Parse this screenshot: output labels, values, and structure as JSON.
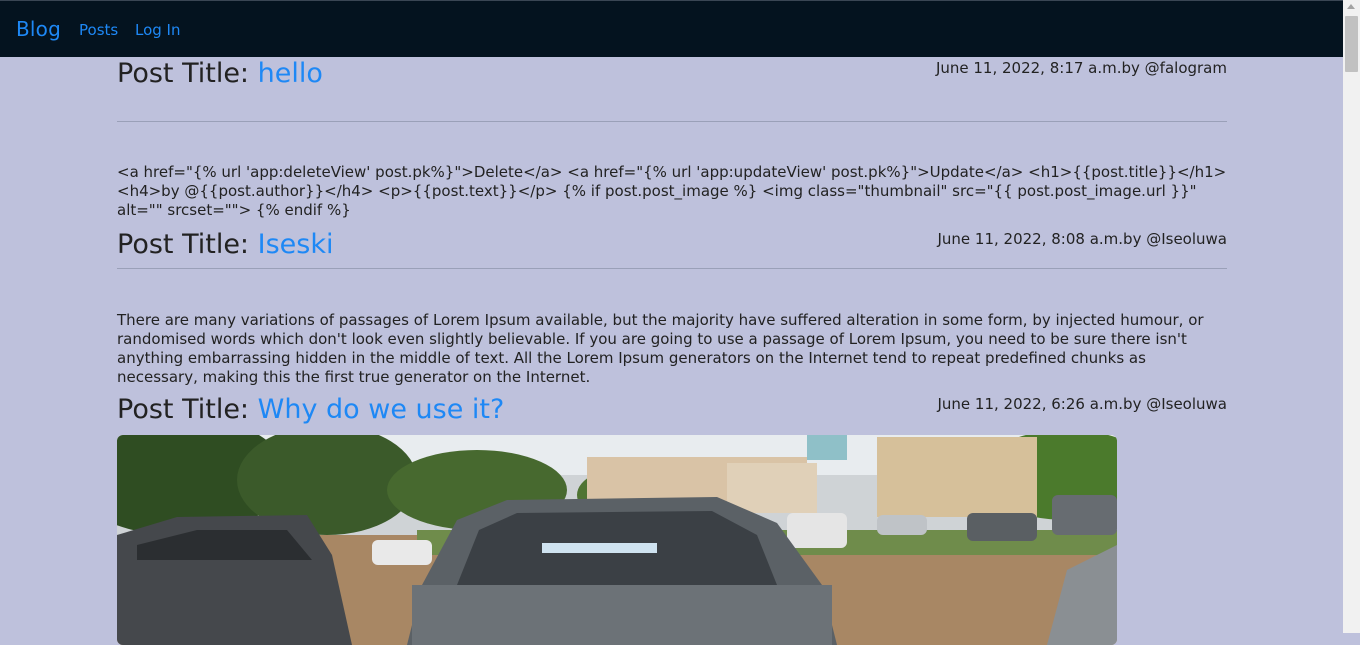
{
  "navbar": {
    "brand": "Blog",
    "links": [
      {
        "label": "Posts"
      },
      {
        "label": "Log In"
      }
    ]
  },
  "posts": [
    {
      "title_prefix": "Post Title:",
      "title": "hello",
      "meta": "June 11, 2022, 8:17 a.m.by @falogram",
      "text": "<a href=\"{% url 'app:deleteView' post.pk%}\">Delete</a> <a href=\"{% url 'app:updateView' post.pk%}\">Update</a> <h1>{{post.title}}</h1> <h4>by @{{post.author}}</h4> <p>{{post.text}}</p> {% if post.post_image %} <img class=\"thumbnail\" src=\"{{ post.post_image.url }}\" alt=\"\" srcset=\"\"> {% endif %}"
    },
    {
      "title_prefix": "Post Title:",
      "title": "Iseski",
      "meta": "June 11, 2022, 8:08 a.m.by @Iseoluwa",
      "text": "There are many variations of passages of Lorem Ipsum available, but the majority have suffered alteration in some form, by injected humour, or randomised words which don't look even slightly believable. If you are going to use a passage of Lorem Ipsum, you need to be sure there isn't anything embarrassing hidden in the middle of text. All the Lorem Ipsum generators on the Internet tend to repeat predefined chunks as necessary, making this the first true generator on the Internet."
    },
    {
      "title_prefix": "Post Title:",
      "title": "Why do we use it?",
      "meta": "June 11, 2022, 6:26 a.m.by @Iseoluwa",
      "image_icon": "post-photo"
    }
  ]
}
